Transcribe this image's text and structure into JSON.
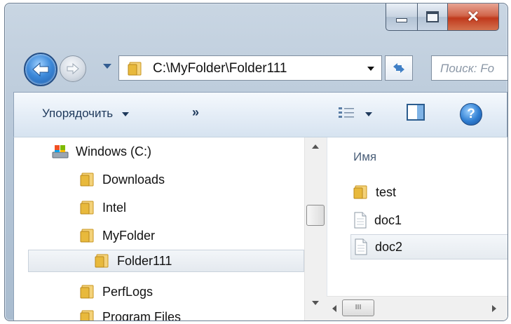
{
  "window": {
    "caption_buttons": {
      "minimize": "minimize-icon",
      "maximize": "maximize-icon",
      "close": "close-icon"
    }
  },
  "address_bar": {
    "path": "C:\\MyFolder\\Folder111",
    "search_placeholder": "Поиск: Fo"
  },
  "toolbar": {
    "organize_label": "Упорядочить",
    "more_label": "»"
  },
  "nav_tree": {
    "items": [
      {
        "label": "Windows (C:)",
        "icon": "drive-icon",
        "selected": false
      },
      {
        "label": "Downloads",
        "icon": "folder-icon",
        "selected": false
      },
      {
        "label": "Intel",
        "icon": "folder-icon",
        "selected": false
      },
      {
        "label": "MyFolder",
        "icon": "folder-icon",
        "selected": false
      },
      {
        "label": "Folder111",
        "icon": "folder-icon",
        "selected": true
      },
      {
        "label": "PerfLogs",
        "icon": "folder-icon",
        "selected": false
      },
      {
        "label": "Program Files",
        "icon": "folder-icon",
        "selected": false
      }
    ]
  },
  "file_list": {
    "column_header": "Имя",
    "items": [
      {
        "label": "test",
        "icon": "folder-icon",
        "selected": false
      },
      {
        "label": "doc1",
        "icon": "document-icon",
        "selected": false
      },
      {
        "label": "doc2",
        "icon": "document-icon",
        "selected": true
      }
    ]
  },
  "scrollbar": {
    "hthumb_grip": "III"
  },
  "colors": {
    "folder_yellow": "#e8b93c",
    "selection_bg": "#e6ebf0",
    "toolbar_text": "#1e395b"
  }
}
